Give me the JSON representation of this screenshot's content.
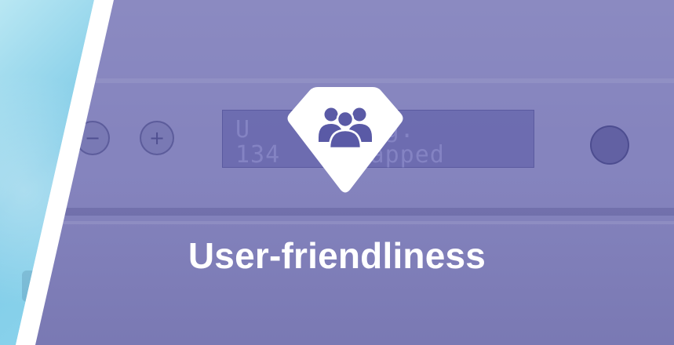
{
  "title": "User-friendliness",
  "badge": {
    "icon": "users-group-icon",
    "shape": "diamond",
    "background_color": "#ffffff",
    "icon_color": "#5a5aa6"
  },
  "background": {
    "left_panel_color": "#8fd3ec",
    "main_overlay_color": "#8584be",
    "divider_color": "#ffffff",
    "lcd_lines": [
      "U      Prog.",
      "134    wrapped"
    ]
  }
}
